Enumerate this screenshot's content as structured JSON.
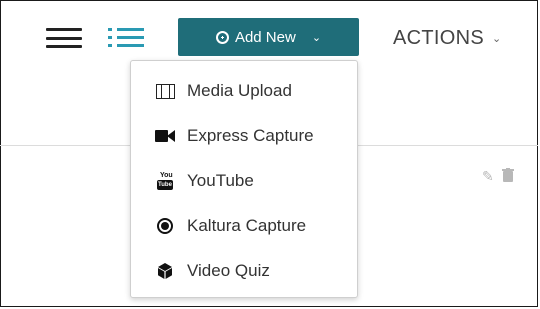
{
  "toolbar": {
    "add_new_label": "Add New",
    "actions_label": "ACTIONS"
  },
  "add_menu": {
    "items": [
      {
        "label": "Media Upload",
        "icon": "film-icon"
      },
      {
        "label": "Express Capture",
        "icon": "videocam-icon"
      },
      {
        "label": "YouTube",
        "icon": "youtube-icon"
      },
      {
        "label": "Kaltura Capture",
        "icon": "record-icon"
      },
      {
        "label": "Video Quiz",
        "icon": "cube-icon"
      }
    ]
  },
  "colors": {
    "accent": "#1f6d79",
    "list_icon": "#2a9ab3",
    "muted_icon": "#b8b8b8"
  }
}
